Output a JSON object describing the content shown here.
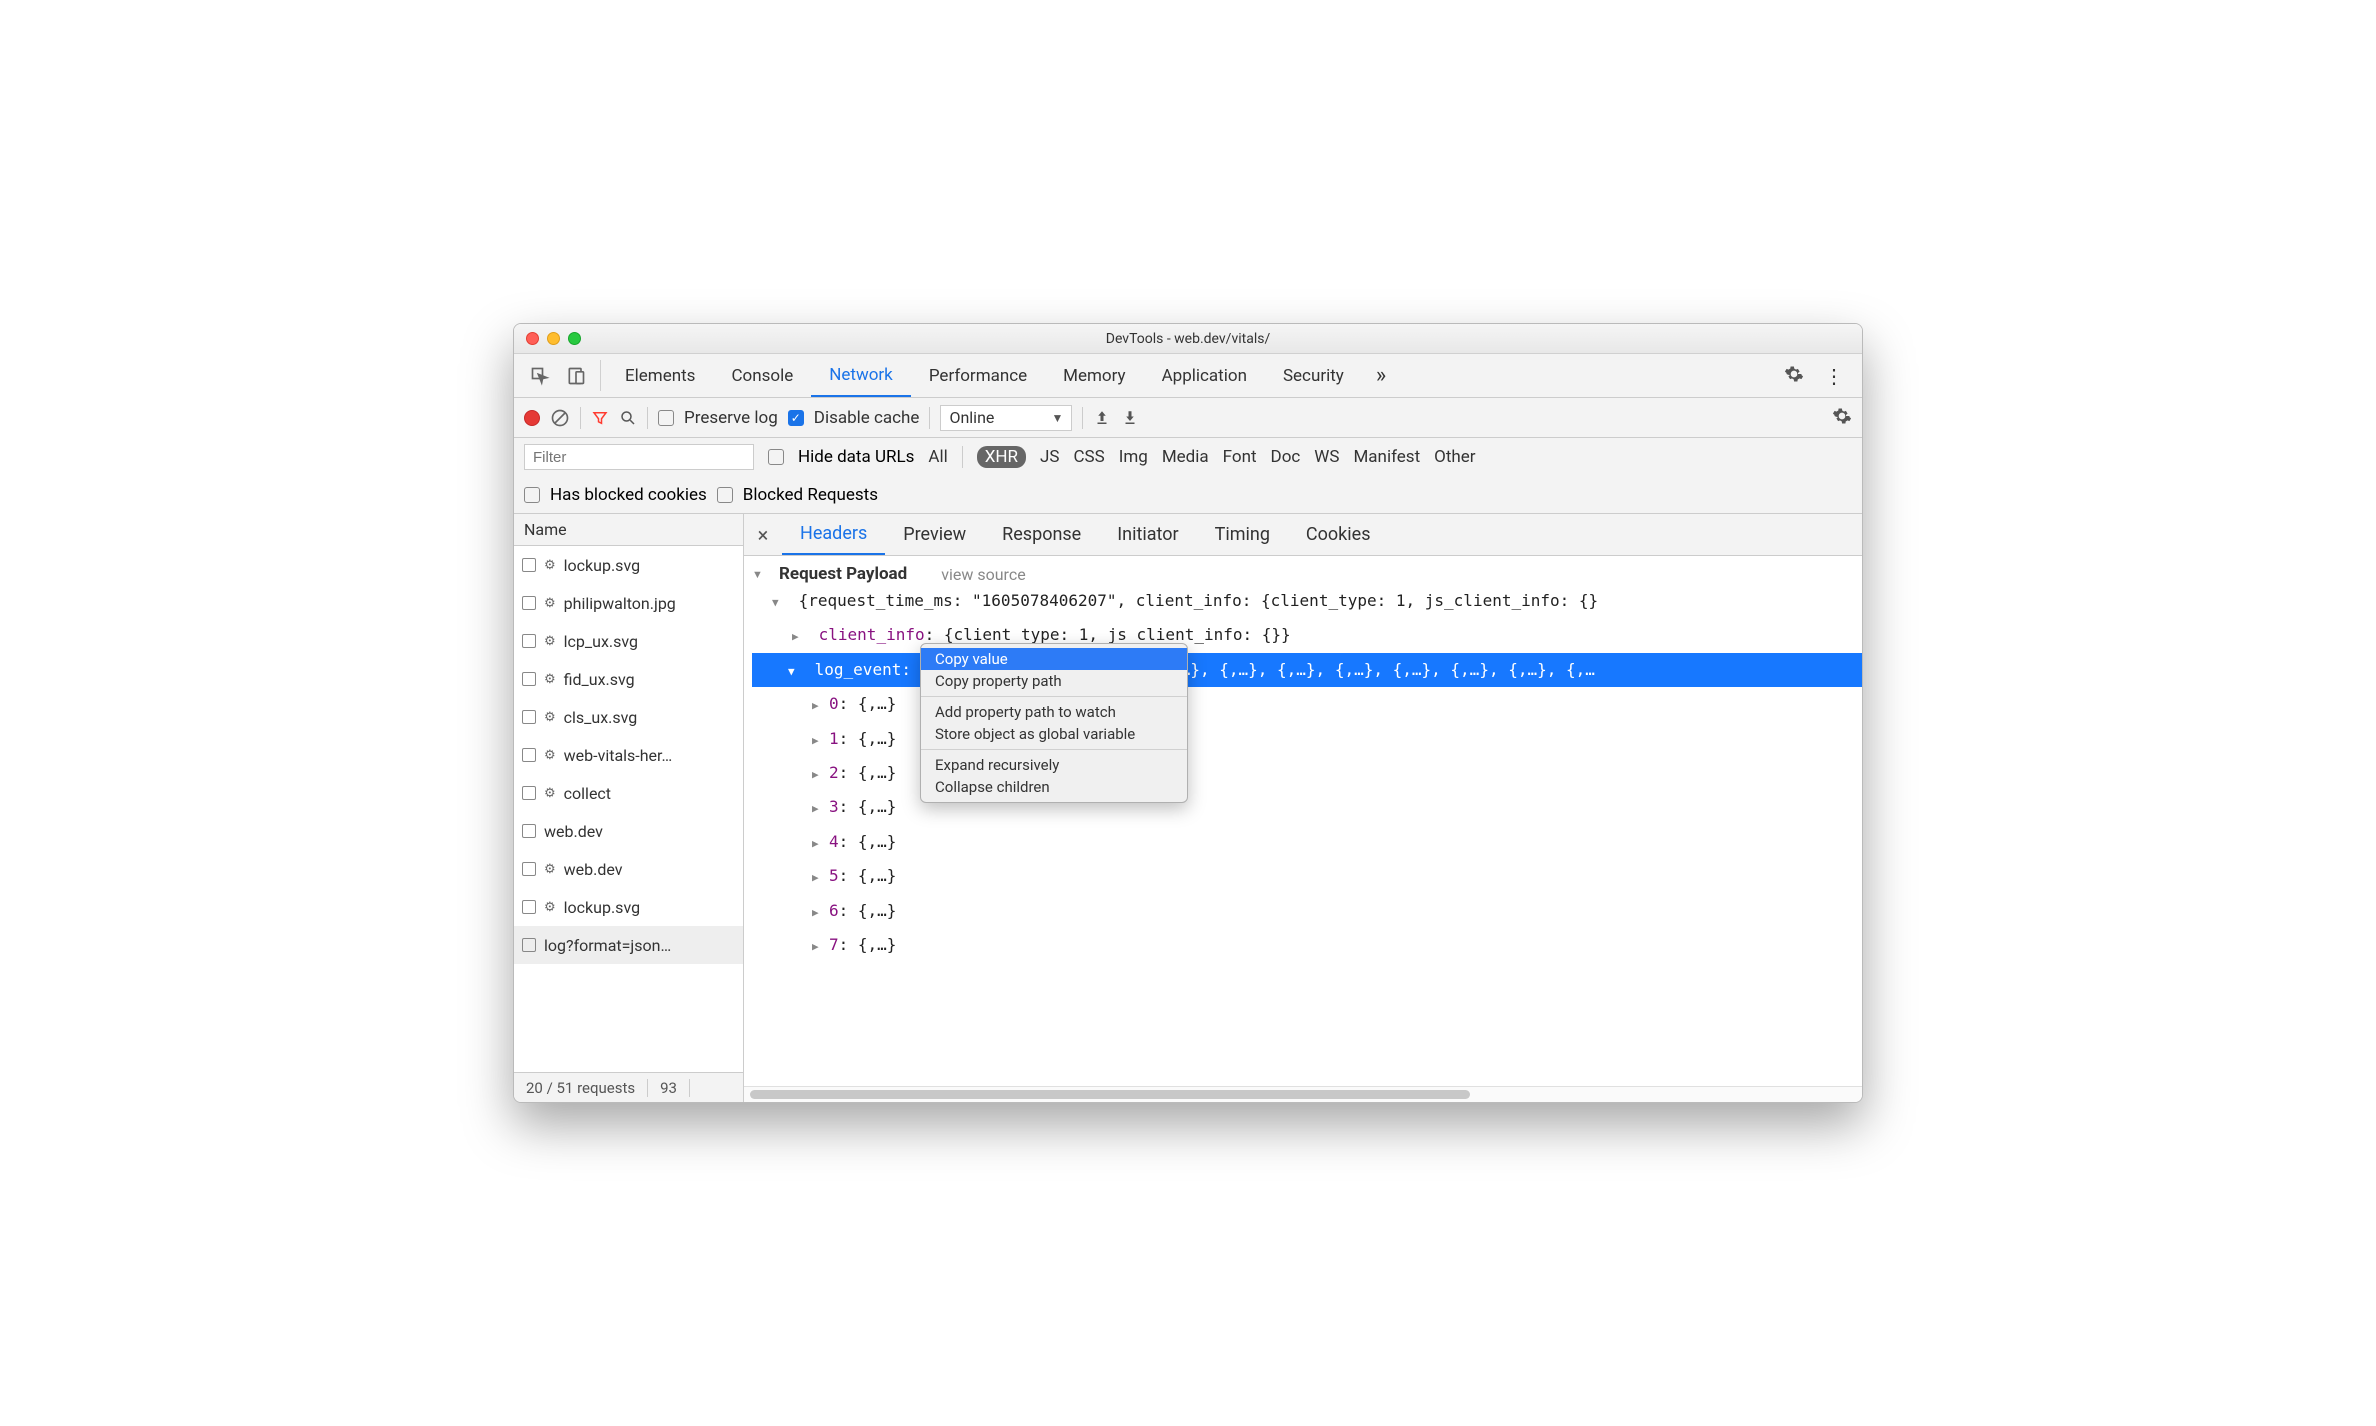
{
  "window": {
    "title": "DevTools - web.dev/vitals/"
  },
  "main_tabs": {
    "items": [
      "Elements",
      "Console",
      "Network",
      "Performance",
      "Memory",
      "Application",
      "Security"
    ],
    "active": "Network",
    "overflow": "»"
  },
  "toolbar": {
    "preserve_log": "Preserve log",
    "disable_cache": "Disable cache",
    "throttling": "Online"
  },
  "filter": {
    "placeholder": "Filter",
    "hide_data_urls": "Hide data URLs",
    "types": [
      "All",
      "XHR",
      "JS",
      "CSS",
      "Img",
      "Media",
      "Font",
      "Doc",
      "WS",
      "Manifest",
      "Other"
    ],
    "active_type": "XHR",
    "has_blocked": "Has blocked cookies",
    "blocked_requests": "Blocked Requests"
  },
  "requests": {
    "column": "Name",
    "items": [
      {
        "gear": true,
        "name": "lockup.svg"
      },
      {
        "gear": true,
        "name": "philipwalton.jpg"
      },
      {
        "gear": true,
        "name": "lcp_ux.svg"
      },
      {
        "gear": true,
        "name": "fid_ux.svg"
      },
      {
        "gear": true,
        "name": "cls_ux.svg"
      },
      {
        "gear": true,
        "name": "web-vitals-her…"
      },
      {
        "gear": true,
        "name": "collect"
      },
      {
        "gear": false,
        "name": "web.dev"
      },
      {
        "gear": true,
        "name": "web.dev"
      },
      {
        "gear": true,
        "name": "lockup.svg"
      },
      {
        "gear": false,
        "name": "log?format=json…",
        "selected": true
      }
    ],
    "status": {
      "left": "20 / 51 requests",
      "right": "93"
    }
  },
  "detail_tabs": {
    "items": [
      "Headers",
      "Preview",
      "Response",
      "Initiator",
      "Timing",
      "Cookies"
    ],
    "active": "Headers"
  },
  "payload": {
    "section_title": "Request Payload",
    "view_source": "view source",
    "root_line": "{request_time_ms: \"1605078406207\", client_info: {client_type: 1, js_client_info: {}",
    "client_info_line": "client_info: {client_type: 1, js_client_info: {}}",
    "log_event_key": "log_event",
    "log_event_preview": "[{,…}, {,…}, {,…}, {,…}, {,…}, {,…}, {,…}, {,…}, {,…}, {,…}, {,…}, {,…",
    "children": [
      {
        "idx": "0",
        "val": "{,…}"
      },
      {
        "idx": "1",
        "val": "{,…}"
      },
      {
        "idx": "2",
        "val": "{,…}"
      },
      {
        "idx": "3",
        "val": "{,…}"
      },
      {
        "idx": "4",
        "val": "{,…}"
      },
      {
        "idx": "5",
        "val": "{,…}"
      },
      {
        "idx": "6",
        "val": "{,…}"
      },
      {
        "idx": "7",
        "val": "{,…}"
      }
    ]
  },
  "context_menu": {
    "items": [
      {
        "label": "Copy value",
        "hl": true
      },
      {
        "label": "Copy property path"
      },
      {
        "sep": true
      },
      {
        "label": "Add property path to watch"
      },
      {
        "label": "Store object as global variable"
      },
      {
        "sep": true
      },
      {
        "label": "Expand recursively"
      },
      {
        "label": "Collapse children"
      }
    ]
  }
}
